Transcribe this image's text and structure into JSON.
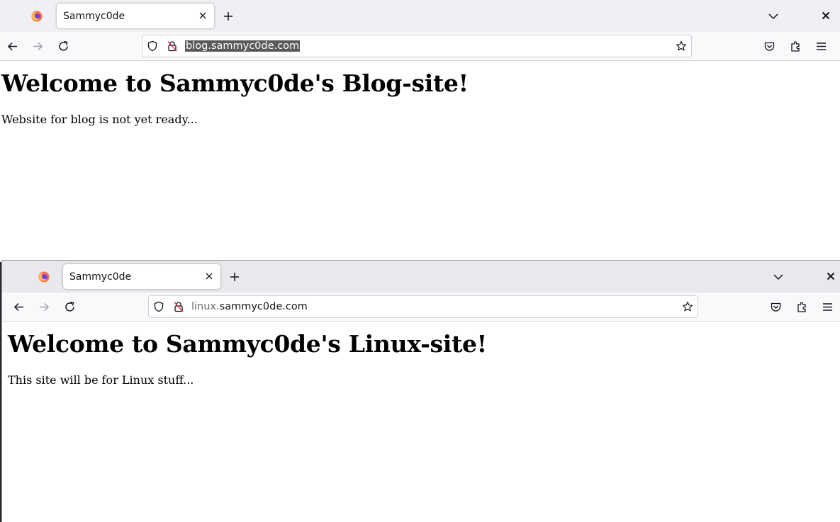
{
  "windows": [
    {
      "tab": {
        "title": "Sammyc0de"
      },
      "url": {
        "selected": "blog.sammyc0de.com",
        "sub": "",
        "domain": ""
      },
      "page": {
        "heading": "Welcome to Sammyc0de's Blog-site!",
        "text": "Website for blog is not yet ready..."
      }
    },
    {
      "tab": {
        "title": "Sammyc0de"
      },
      "url": {
        "selected": "",
        "sub": "linux.",
        "domain": "sammyc0de.com"
      },
      "page": {
        "heading": "Welcome to Sammyc0de's Linux-site!",
        "text": "This site will be for Linux stuff..."
      }
    }
  ],
  "icons": [
    "firefox-icon",
    "close-icon",
    "plus-icon",
    "chevron-down-icon",
    "back-arrow-icon",
    "forward-arrow-icon",
    "reload-icon",
    "shield-icon",
    "insecure-lock-icon",
    "star-icon",
    "pocket-icon",
    "extensions-icon",
    "hamburger-menu-icon"
  ]
}
